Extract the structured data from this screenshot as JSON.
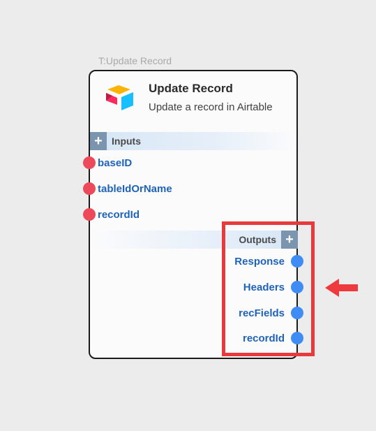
{
  "node": {
    "tag": "T:Update Record",
    "title": "Update Record",
    "description": "Update a record in Airtable",
    "logo_icon": "airtable-logo"
  },
  "inputs": {
    "label": "Inputs",
    "add_icon": "+",
    "ports": [
      {
        "label": "baseID"
      },
      {
        "label": "tableIdOrName"
      },
      {
        "label": "recordId"
      }
    ]
  },
  "outputs": {
    "label": "Outputs",
    "add_icon": "+",
    "ports": [
      {
        "label": "Response"
      },
      {
        "label": "Headers"
      },
      {
        "label": "recFields"
      },
      {
        "label": "recordId"
      }
    ]
  },
  "annotations": {
    "highlight_color": "#e8393c",
    "arrow_icon": "left-arrow-icon"
  },
  "colors": {
    "input_port": "#ec4a5b",
    "output_port": "#3f8cf4",
    "port_label": "#1f63b8",
    "plus_button": "#7a95ad"
  }
}
